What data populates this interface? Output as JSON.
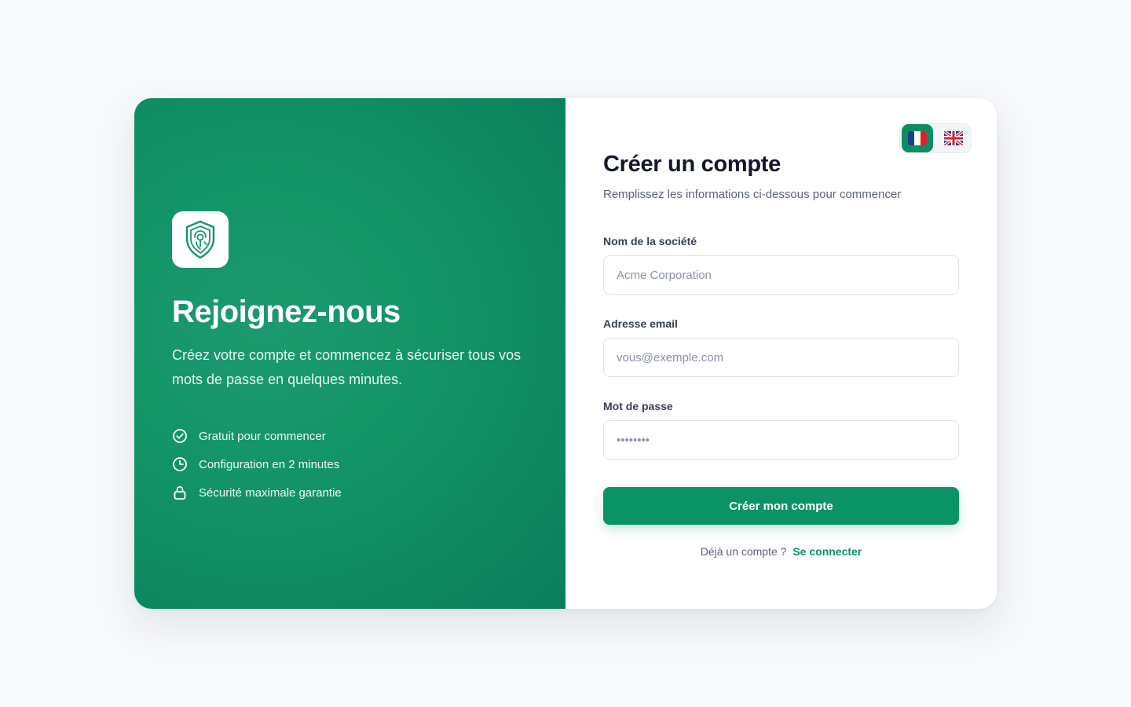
{
  "brand": {
    "accent_color": "#0a9466",
    "panel_gradient": [
      "#1c9a6e",
      "#0b7e5a"
    ],
    "logo_icon": "shield-fingerprint-icon"
  },
  "hero": {
    "title": "Rejoignez-nous",
    "subtitle": "Créez votre compte et commencez à sécuriser tous vos mots de passe en quelques minutes.",
    "features": [
      {
        "icon": "check-circle-icon",
        "label": "Gratuit pour commencer"
      },
      {
        "icon": "clock-icon",
        "label": "Configuration en 2 minutes"
      },
      {
        "icon": "lock-icon",
        "label": "Sécurité maximale garantie"
      }
    ]
  },
  "language_switcher": {
    "options": [
      {
        "code": "fr",
        "icon": "flag-fr-icon",
        "active": true
      },
      {
        "code": "en",
        "icon": "flag-uk-icon",
        "active": false
      }
    ]
  },
  "form": {
    "title": "Créer un compte",
    "subtitle": "Remplissez les informations ci-dessous pour commencer",
    "company": {
      "label": "Nom de la société",
      "placeholder": "Acme Corporation",
      "value": ""
    },
    "email": {
      "label": "Adresse email",
      "placeholder": "vous@exemple.com",
      "value": ""
    },
    "password": {
      "label": "Mot de passe",
      "placeholder": "••••••••",
      "value": ""
    },
    "submit_label": "Créer mon compte",
    "login_prompt": "Déjà un compte ?",
    "login_link": "Se connecter"
  }
}
